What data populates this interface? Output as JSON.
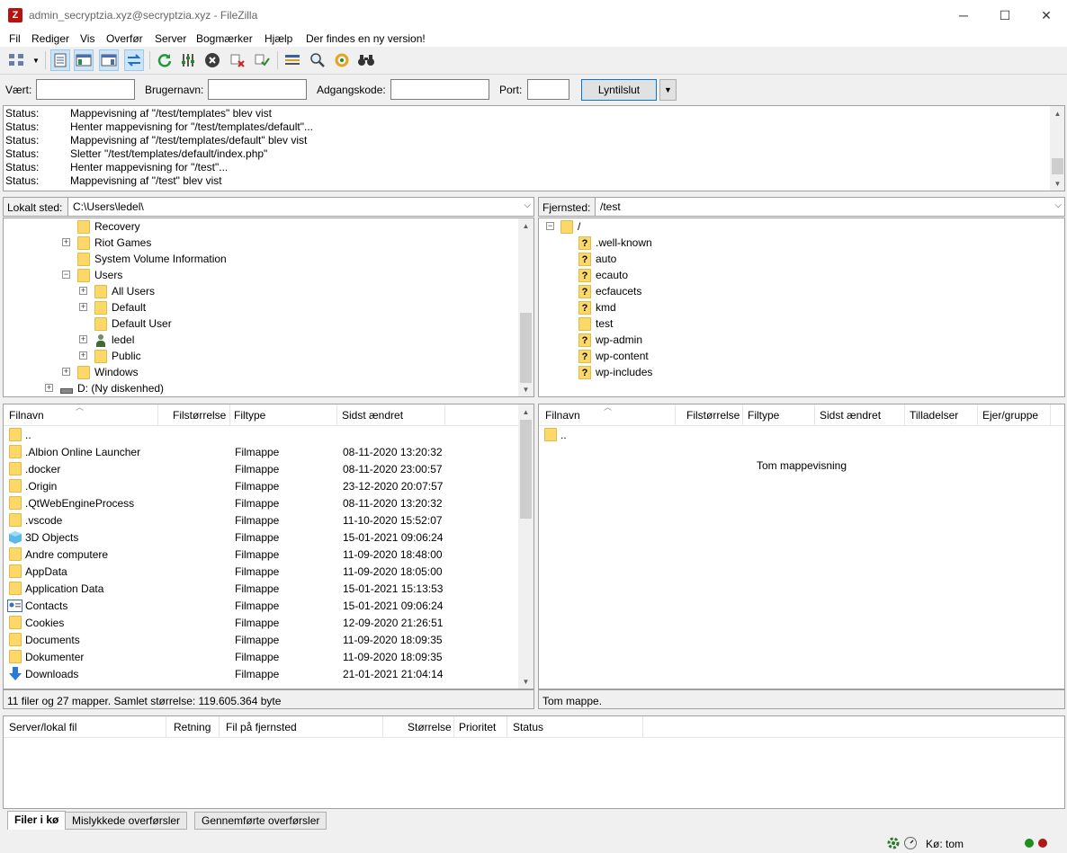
{
  "window": {
    "title": "admin_secryptzia.xyz@secryptzia.xyz - FileZilla",
    "app_icon_letter": "Z",
    "minimize": "─",
    "maximize": "☐",
    "close": "✕"
  },
  "menu": [
    "Fil",
    "Rediger",
    "Vis",
    "Overfør",
    "Server",
    "Bogmærker",
    "Hjælp",
    "Der findes en ny version!"
  ],
  "quickconnect": {
    "host_label": "Vært:",
    "host_value": "",
    "user_label": "Brugernavn:",
    "user_value": "",
    "pass_label": "Adgangskode:",
    "pass_value": "",
    "port_label": "Port:",
    "port_value": "",
    "button": "Lyntilslut",
    "dropdown": "▼"
  },
  "log": [
    {
      "k": "Status:",
      "v": "Mappevisning af \"/test/templates\" blev vist"
    },
    {
      "k": "Status:",
      "v": "Henter mappevisning for \"/test/templates/default\"..."
    },
    {
      "k": "Status:",
      "v": "Mappevisning af \"/test/templates/default\" blev vist"
    },
    {
      "k": "Status:",
      "v": "Sletter \"/test/templates/default/index.php\""
    },
    {
      "k": "Status:",
      "v": "Henter mappevisning for \"/test\"..."
    },
    {
      "k": "Status:",
      "v": "Mappevisning af \"/test\" blev vist"
    }
  ],
  "local": {
    "site_label": "Lokalt sted:",
    "path": "C:\\Users\\ledel\\",
    "tree": [
      {
        "label": "Recovery",
        "icon": "folder",
        "expander": ""
      },
      {
        "label": "Riot Games",
        "icon": "folder",
        "expander": "+"
      },
      {
        "label": "System Volume Information",
        "icon": "folder",
        "expander": ""
      },
      {
        "label": "Users",
        "icon": "folder",
        "expander": "−"
      },
      {
        "label": "All Users",
        "icon": "folder",
        "expander": "+"
      },
      {
        "label": "Default",
        "icon": "folder",
        "expander": "+"
      },
      {
        "label": "Default User",
        "icon": "folder",
        "expander": ""
      },
      {
        "label": "ledel",
        "icon": "user",
        "expander": "+"
      },
      {
        "label": "Public",
        "icon": "folder",
        "expander": "+"
      },
      {
        "label": "Windows",
        "icon": "folder",
        "expander": "+"
      },
      {
        "label": "D: (Ny diskenhed)",
        "icon": "drive",
        "expander": "+"
      }
    ],
    "columns": [
      "Filnavn",
      "Filstørrelse",
      "Filtype",
      "Sidst ændret"
    ],
    "files": [
      {
        "name": "..",
        "type": "",
        "date": "",
        "icon": "folder"
      },
      {
        "name": ".Albion Online Launcher",
        "type": "Filmappe",
        "date": "08-11-2020 13:20:32",
        "icon": "folder"
      },
      {
        "name": ".docker",
        "type": "Filmappe",
        "date": "08-11-2020 23:00:57",
        "icon": "folder"
      },
      {
        "name": ".Origin",
        "type": "Filmappe",
        "date": "23-12-2020 20:07:57",
        "icon": "folder"
      },
      {
        "name": ".QtWebEngineProcess",
        "type": "Filmappe",
        "date": "08-11-2020 13:20:32",
        "icon": "folder"
      },
      {
        "name": ".vscode",
        "type": "Filmappe",
        "date": "11-10-2020 15:52:07",
        "icon": "folder"
      },
      {
        "name": "3D Objects",
        "type": "Filmappe",
        "date": "15-01-2021 09:06:24",
        "icon": "cube"
      },
      {
        "name": "Andre computere",
        "type": "Filmappe",
        "date": "11-09-2020 18:48:00",
        "icon": "folder"
      },
      {
        "name": "AppData",
        "type": "Filmappe",
        "date": "11-09-2020 18:05:00",
        "icon": "folder"
      },
      {
        "name": "Application Data",
        "type": "Filmappe",
        "date": "15-01-2021 15:13:53",
        "icon": "folder"
      },
      {
        "name": "Contacts",
        "type": "Filmappe",
        "date": "15-01-2021 09:06:24",
        "icon": "contacts"
      },
      {
        "name": "Cookies",
        "type": "Filmappe",
        "date": "12-09-2020 21:26:51",
        "icon": "folder"
      },
      {
        "name": "Documents",
        "type": "Filmappe",
        "date": "11-09-2020 18:09:35",
        "icon": "folder"
      },
      {
        "name": "Dokumenter",
        "type": "Filmappe",
        "date": "11-09-2020 18:09:35",
        "icon": "folder"
      },
      {
        "name": "Downloads",
        "type": "Filmappe",
        "date": "21-01-2021 21:04:14",
        "icon": "download"
      }
    ],
    "status": "11 filer og 27 mapper. Samlet størrelse: 119.605.364 byte"
  },
  "remote": {
    "site_label": "Fjernsted:",
    "path": "/test",
    "tree_root": "/",
    "tree": [
      {
        "label": ".well-known",
        "icon": "q"
      },
      {
        "label": "auto",
        "icon": "q"
      },
      {
        "label": "ecauto",
        "icon": "q"
      },
      {
        "label": "ecfaucets",
        "icon": "q"
      },
      {
        "label": "kmd",
        "icon": "q"
      },
      {
        "label": "test",
        "icon": "folder"
      },
      {
        "label": "wp-admin",
        "icon": "q"
      },
      {
        "label": "wp-content",
        "icon": "q"
      },
      {
        "label": "wp-includes",
        "icon": "q"
      }
    ],
    "columns": [
      "Filnavn",
      "Filstørrelse",
      "Filtype",
      "Sidst ændret",
      "Tilladelser",
      "Ejer/gruppe"
    ],
    "parent_row": "..",
    "empty_text": "Tom mappevisning",
    "status": "Tom mappe."
  },
  "queue": {
    "columns": [
      "Server/lokal fil",
      "Retning",
      "Fil på fjernsted",
      "Størrelse",
      "Prioritet",
      "Status"
    ],
    "tabs": [
      "Filer i kø",
      "Mislykkede overførsler",
      "Gennemførte overførsler"
    ]
  },
  "statusbar": {
    "queue_text": "Kø: tom"
  },
  "colors": {
    "folder": "#fcd869",
    "accent": "#0078d7",
    "led_green": "#1a8f1a",
    "led_red": "#b01818"
  }
}
